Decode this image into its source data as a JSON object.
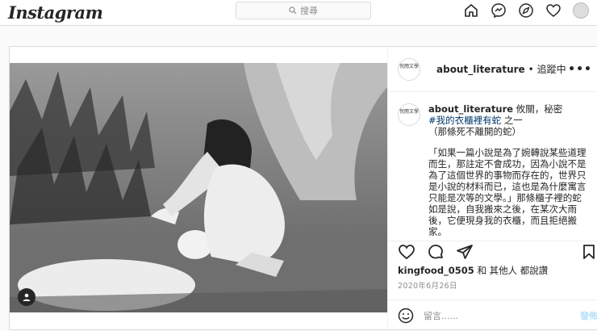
{
  "nav": {
    "logo": "Instagram",
    "search_placeholder": "搜尋",
    "icons": [
      "home-icon",
      "messenger-icon",
      "explore-icon",
      "heart-icon",
      "avatar"
    ]
  },
  "post": {
    "header": {
      "avatar_text": "悅閱文學",
      "username": "about_literature",
      "follow_status": "• 追蹤中"
    },
    "caption": {
      "username": "about_literature",
      "line1_rest": " 攸關，秘密",
      "hashtag": "#我的衣櫃裡有蛇",
      "hashtag_rest": " 之一",
      "line3": "（那條死不離開的蛇）",
      "body": "「如果一篇小說是為了婉轉說某些道理而生，那註定不會成功，因為小說不是為了這個世界的事物而存在的，世界只是小說的材料而已，這也是為什麼寓言只能是次等的文學。」那條櫃子裡的蛇如是說，自我搬來之後，在某次大雨後，它便現身我的衣櫃，而且拒絕搬家。"
    },
    "likes": {
      "user": "kingfood_0505",
      "rest": " 和 其他人 都說讚"
    },
    "date": "2020年6月26日",
    "comment_placeholder": "留言......",
    "post_button": "發佈"
  }
}
